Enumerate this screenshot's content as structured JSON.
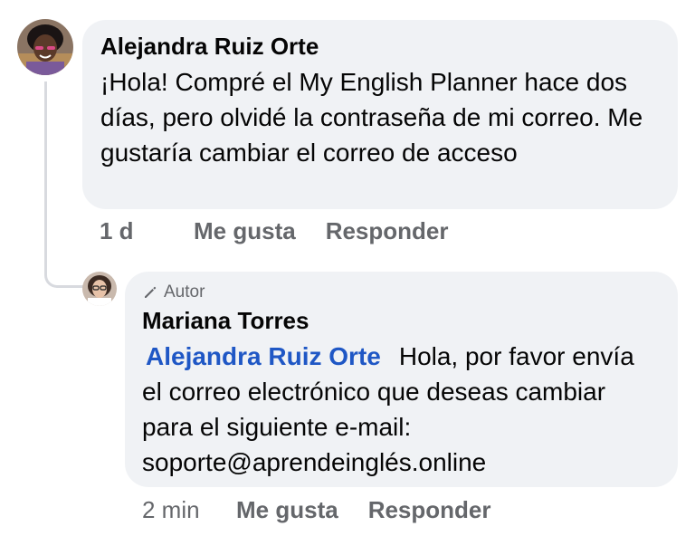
{
  "comment": {
    "author": "Alejandra Ruiz Orte",
    "text": "¡Hola! Compré el My English Planner hace dos días, pero olvidé la contraseña de mi correo. Me gustaría cambiar el correo de acceso",
    "time": "1 d",
    "like_label": "Me gusta",
    "reply_label": "Responder"
  },
  "reply": {
    "badge_icon": "pencil-icon",
    "badge": "Autor",
    "author": "Mariana Torres",
    "mention": "Alejandra Ruiz Orte",
    "text": "Hola, por favor envía el correo electrónico que deseas cambiar para el siguiente e-mail: soporte@aprendeinglés.online",
    "time": "2 min",
    "like_label": "Me gusta",
    "reply_label": "Responder"
  },
  "colors": {
    "bubble_bg": "#f0f2f5",
    "mention": "#1f57c5",
    "secondary_text": "#65676b"
  }
}
